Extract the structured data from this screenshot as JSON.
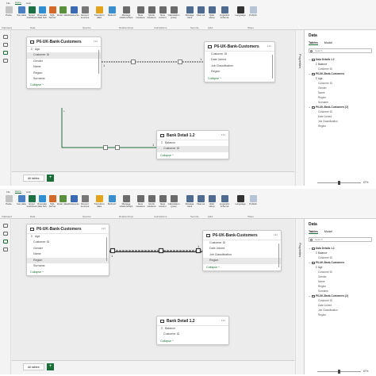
{
  "ribbon": {
    "tabs": [
      "File",
      "Home",
      "Help"
    ],
    "active_tab": 1,
    "buttons": [
      {
        "label": "Paste",
        "color": "#c4c4c4"
      },
      {
        "label": "Get data",
        "color": "#4a7fc1"
      },
      {
        "label": "Excel workbook",
        "color": "#1e7145"
      },
      {
        "label": "OneLake data hub",
        "color": "#2f8fd0"
      },
      {
        "label": "SQL Server",
        "color": "#d16a2a"
      },
      {
        "label": "Enter data",
        "color": "#5a8f3c"
      },
      {
        "label": "Dataverse",
        "color": "#3a6ab3"
      },
      {
        "label": "Recent sources",
        "color": "#777777"
      },
      {
        "label": "Transform data",
        "color": "#e2a41d"
      },
      {
        "label": "Refresh",
        "color": "#3c8fcf"
      },
      {
        "label": "Manage relationships",
        "color": "#6b6b6b"
      },
      {
        "label": "New measure",
        "color": "#6b6b6b"
      },
      {
        "label": "Quick measure",
        "color": "#6b6b6b"
      },
      {
        "label": "New column",
        "color": "#6b6b6b"
      },
      {
        "label": "Calculation group",
        "color": "#6b6b6b"
      },
      {
        "label": "Manage roles",
        "color": "#4f6b8f"
      },
      {
        "label": "View as",
        "color": "#4f6b8f"
      },
      {
        "label": "Q&A setup",
        "color": "#4f6b8f"
      },
      {
        "label": "Linguistic schema",
        "color": "#4f6b8f"
      },
      {
        "label": "Language",
        "color": "#333333"
      },
      {
        "label": "Publish",
        "color": "#b7c4d6"
      }
    ],
    "groups": [
      "Clipboard",
      "Data",
      "Queries",
      "Relationships",
      "Calculations",
      "Security",
      "Q&A",
      "Share"
    ]
  },
  "properties_label": "Properties",
  "data_pane": {
    "title": "Data",
    "tabs": [
      "Tables",
      "Model"
    ],
    "active_tab": 0,
    "search_placeholder": "Search",
    "tree": [
      {
        "kind": "table",
        "label": "Data Details 1.2"
      },
      {
        "kind": "sigma",
        "label": "Balance"
      },
      {
        "kind": "child",
        "label": "Customer ID"
      },
      {
        "kind": "table",
        "label": "P6-UK-Bank-Customers"
      },
      {
        "kind": "sigma",
        "label": "Age"
      },
      {
        "kind": "child",
        "label": "Customer ID"
      },
      {
        "kind": "child",
        "label": "Gender"
      },
      {
        "kind": "child",
        "label": "Name"
      },
      {
        "kind": "child",
        "label": "Region"
      },
      {
        "kind": "child",
        "label": "Surname"
      },
      {
        "kind": "table",
        "label": "P6-UK-Bank-Customers (2)"
      },
      {
        "kind": "child",
        "label": "Customer ID"
      },
      {
        "kind": "child",
        "label": "Date Joined"
      },
      {
        "kind": "child",
        "label": "Job Classification"
      },
      {
        "kind": "child",
        "label": "Region"
      }
    ]
  },
  "status": {
    "page_tab": "All tables",
    "add_tab": "+",
    "zoom": "67%"
  },
  "cards": {
    "customers": {
      "title": "P6-UK-Bank-Customers",
      "menu": "···",
      "fields": [
        {
          "label": "Age",
          "sigma": "Σ"
        },
        {
          "label": "Customer ID",
          "sigma": ""
        },
        {
          "label": "Gender",
          "sigma": ""
        },
        {
          "label": "Name",
          "sigma": ""
        },
        {
          "label": "Region",
          "sigma": ""
        },
        {
          "label": "Surname",
          "sigma": ""
        }
      ],
      "collapse": "Collapse ^"
    },
    "customers2": {
      "title": "P6-UK-Bank-Customers",
      "menu": "···",
      "fields": [
        {
          "label": "Customer ID",
          "sigma": ""
        },
        {
          "label": "Date Joined",
          "sigma": ""
        },
        {
          "label": "Job Classification",
          "sigma": ""
        },
        {
          "label": "Region",
          "sigma": ""
        }
      ],
      "collapse": "Collapse ^"
    },
    "bank": {
      "title": "Bank Detail 1.2",
      "menu": "···",
      "fields": [
        {
          "label": "Balance",
          "sigma": "Σ"
        },
        {
          "label": "Customer ID",
          "sigma": ""
        }
      ],
      "collapse": "Collapse ^"
    }
  },
  "screens": [
    {
      "selected": {
        "customers": 1,
        "customers2": -1,
        "bank": 1
      }
    },
    {
      "selected": {
        "customers": 4,
        "customers2": 3,
        "bank": -1
      }
    }
  ],
  "relationship": {
    "one": "1",
    "many": "*"
  },
  "colors": {
    "accent": "#1b6e37",
    "line": "#444444"
  }
}
